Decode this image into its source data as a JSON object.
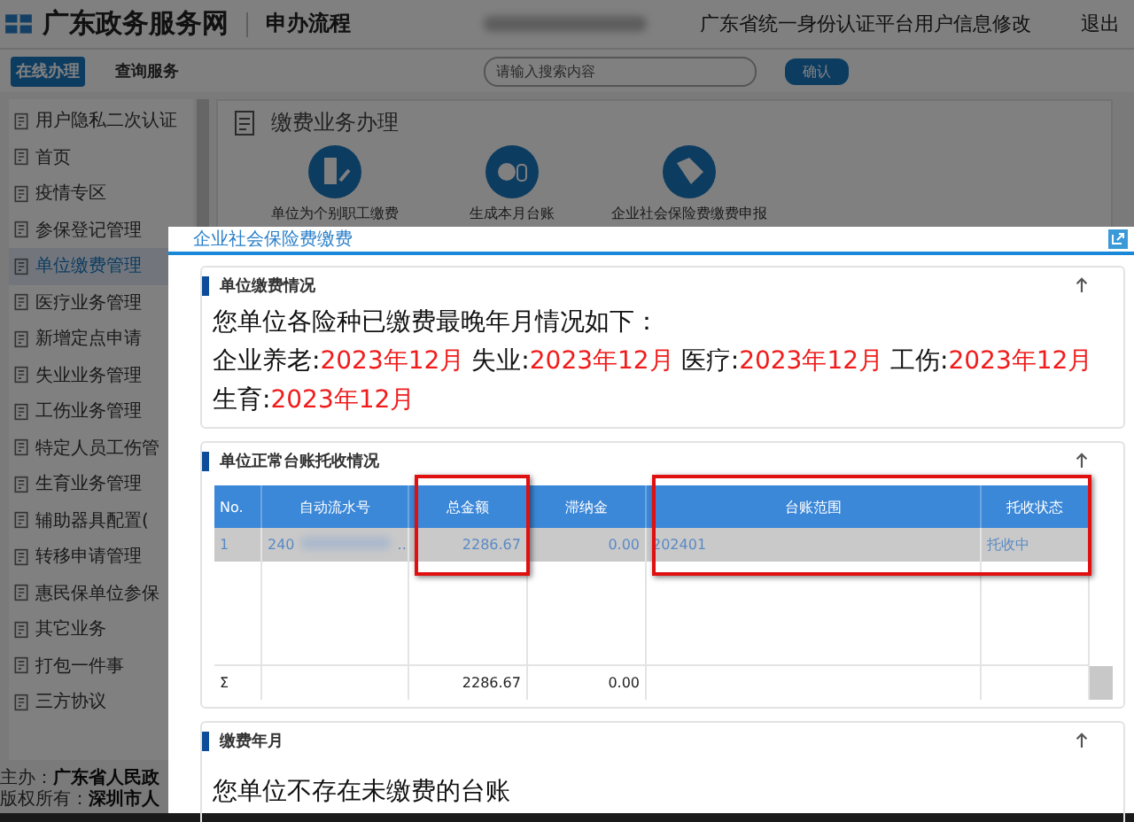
{
  "header": {
    "site_title": "广东政务服务网",
    "section_title": "申办流程",
    "user_name_redacted": true,
    "profile_link": "广东省统一身份认证平台用户信息修改",
    "logout": "退出"
  },
  "toolbar": {
    "tabs": [
      {
        "label": "在线办理",
        "selected": true
      },
      {
        "label": "查询服务",
        "selected": false
      }
    ],
    "search": {
      "placeholder": "请输入搜索内容"
    },
    "confirm_button": "确认"
  },
  "sidebar": {
    "items": [
      {
        "label": "用户隐私二次认证",
        "selected": false
      },
      {
        "label": "首页",
        "selected": false
      },
      {
        "label": "疫情专区",
        "selected": false
      },
      {
        "label": "参保登记管理",
        "selected": false
      },
      {
        "label": "单位缴费管理",
        "selected": true
      },
      {
        "label": "医疗业务管理",
        "selected": false
      },
      {
        "label": "新增定点申请",
        "selected": false
      },
      {
        "label": "失业业务管理",
        "selected": false
      },
      {
        "label": "工伤业务管理",
        "selected": false
      },
      {
        "label": "特定人员工伤管",
        "selected": false
      },
      {
        "label": "生育业务管理",
        "selected": false
      },
      {
        "label": "辅助器具配置(",
        "selected": false
      },
      {
        "label": "转移申请管理",
        "selected": false
      },
      {
        "label": "惠民保单位参保",
        "selected": false
      },
      {
        "label": "其它业务",
        "selected": false
      },
      {
        "label": "打包一件事",
        "selected": false
      },
      {
        "label": "三方协议",
        "selected": false
      }
    ]
  },
  "content": {
    "title": "缴费业务办理",
    "actions": [
      {
        "label": "单位为个别职工缴费"
      },
      {
        "label": "生成本月台账"
      },
      {
        "label": "企业社会保险费缴费申报"
      }
    ]
  },
  "footer": {
    "lines": [
      {
        "label": "主办：",
        "value": "广东省人民政"
      },
      {
        "label": "版权所有：",
        "value": "深圳市人"
      }
    ]
  },
  "dialog": {
    "title": "企业社会保险费缴费",
    "payment_status": {
      "title": "单位缴费情况",
      "intro": "您单位各险种已缴费最晚年月情况如下：",
      "items": [
        {
          "label": "企业养老:",
          "value": "2023年12月"
        },
        {
          "label": "失业:",
          "value": "2023年12月"
        },
        {
          "label": "医疗:",
          "value": "2023年12月"
        },
        {
          "label": "工伤:",
          "value": "2023年12月"
        },
        {
          "label": "生育:",
          "value": "2023年12月"
        }
      ]
    },
    "collection": {
      "title": "单位正常台账托收情况",
      "columns": [
        {
          "label": "No.",
          "outlined": false
        },
        {
          "label": "自动流水号",
          "outlined": false
        },
        {
          "label": "总金额",
          "outlined": true
        },
        {
          "label": "滞纳金",
          "outlined": false
        },
        {
          "label": "台账范围",
          "outlined": true
        },
        {
          "label": "托收状态",
          "outlined": true
        }
      ],
      "rows": [
        {
          "selected": true,
          "cells": [
            {
              "text": "1"
            },
            {
              "text": "240",
              "redacted": true,
              "suffix": ".."
            },
            {
              "text": "2286.67"
            },
            {
              "text": "0.00"
            },
            {
              "text": "202401"
            },
            {
              "text": "托收中"
            }
          ]
        }
      ],
      "total": {
        "symbol": "Σ",
        "amount": "2286.67",
        "late_fee": "0.00"
      }
    },
    "payment_month": {
      "title": "缴费年月",
      "message": "您单位不存在未缴费的台账"
    }
  }
}
